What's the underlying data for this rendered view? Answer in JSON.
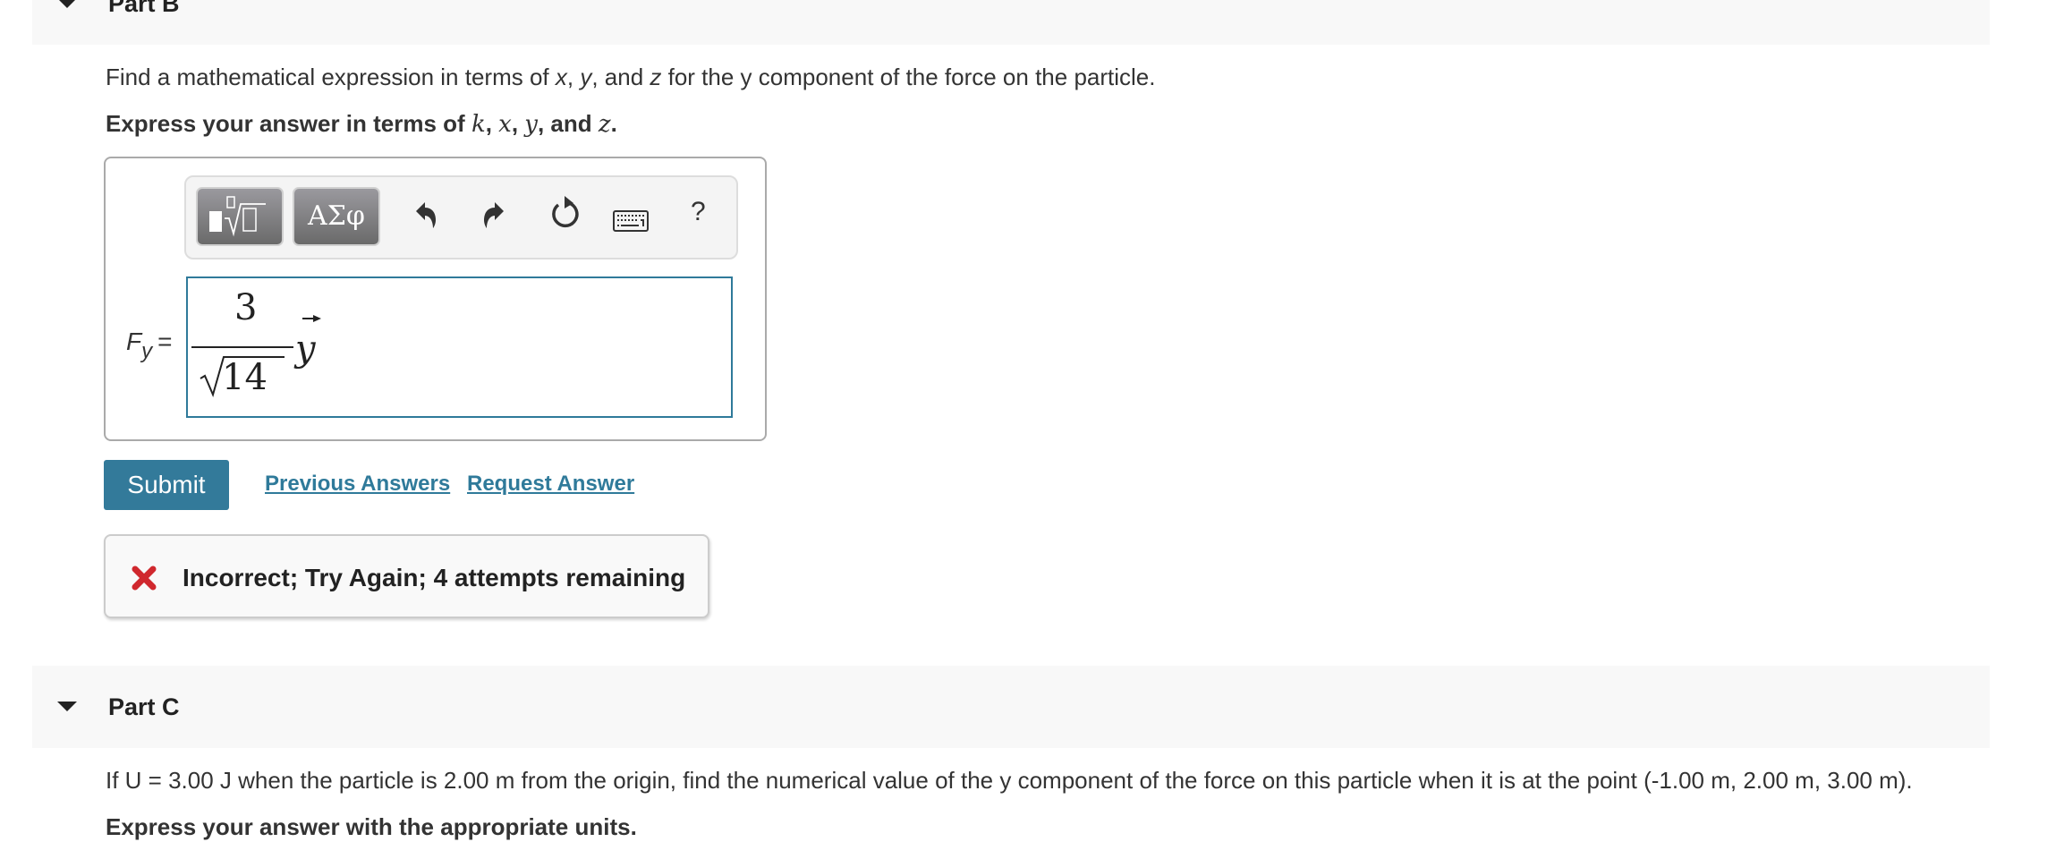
{
  "partB": {
    "title": "Part B",
    "question": {
      "pre": "Find a mathematical expression in terms of ",
      "var1": "x",
      "sep1": ", ",
      "var2": "y",
      "sep2": ", and ",
      "var3": "z",
      "post": " for the y component of the force on the particle."
    },
    "instruction": {
      "pre": "Express your answer in terms of ",
      "v1": "k",
      "s1": ", ",
      "v2": "x",
      "s2": ", ",
      "v3": "y",
      "s3": ", and ",
      "v4": "z",
      "post": "."
    },
    "toolbar": {
      "templates_icon": "templates-radical-icon",
      "symbols_label": "ΑΣφ",
      "undo_icon": "undo-icon",
      "redo_icon": "redo-icon",
      "reset_icon": "reset-icon",
      "keyboard_icon": "keyboard-icon",
      "help_label": "?"
    },
    "answer_label": {
      "F": "F",
      "sub": "y",
      "eq": "="
    },
    "answer_value": {
      "numerator": "3",
      "radicand": "14",
      "vector": "y",
      "latex": "\\frac{3}{\\sqrt{14}}\\vec{y}"
    },
    "submit_label": "Submit",
    "previous_answers_label": "Previous Answers",
    "request_answer_label": "Request Answer",
    "feedback": {
      "icon": "x-mark-icon",
      "message": "Incorrect; Try Again; 4 attempts remaining",
      "color": "#d0282e"
    }
  },
  "partC": {
    "title": "Part C",
    "question": "If U = 3.00 J when the particle is 2.00 m from the origin, find the numerical value of the y component of the force on this particle when it is at the point (-1.00 m, 2.00 m, 3.00 m).",
    "instruction": "Express your answer with the appropriate units."
  },
  "colors": {
    "accent": "#337a9a",
    "link": "#2f7a9a",
    "band": "#f8f8f8",
    "error": "#d0282e"
  }
}
